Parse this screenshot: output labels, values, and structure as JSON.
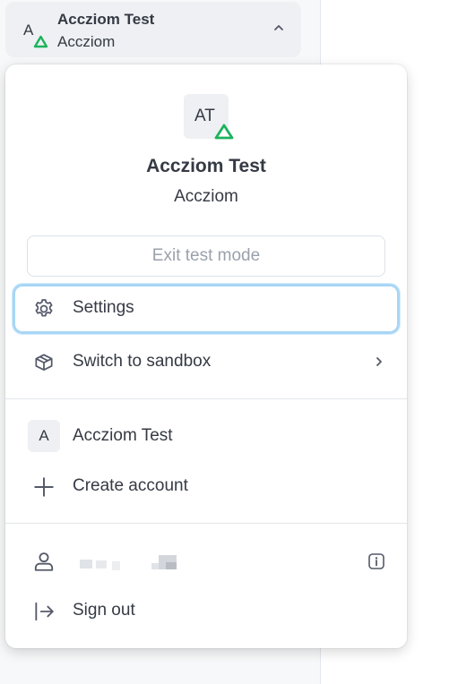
{
  "switcher": {
    "name": "Accziom Test",
    "subtitle": "Accziom",
    "avatar_letter": "A",
    "chevron_icon": "chevron-up-icon"
  },
  "profile": {
    "avatar_initials": "AT",
    "name": "Accziom Test",
    "subtitle": "Accziom",
    "badge_icon": "green-triangle-icon"
  },
  "exit_test_mode_label": "Exit test mode",
  "menu_items": [
    {
      "label": "Settings",
      "icon": "gear-icon"
    },
    {
      "label": "Switch to sandbox",
      "icon": "cube-icon"
    }
  ],
  "accounts": [
    {
      "label": "Accziom Test",
      "avatar_letter": "A"
    }
  ],
  "create_account_label": "Create account",
  "sign_out_label": "Sign out",
  "colors": {
    "accent_green": "#1bb35c",
    "focus_ring": "#a8d6f5",
    "text": "#353a44",
    "muted_text": "#9aa1ac"
  }
}
